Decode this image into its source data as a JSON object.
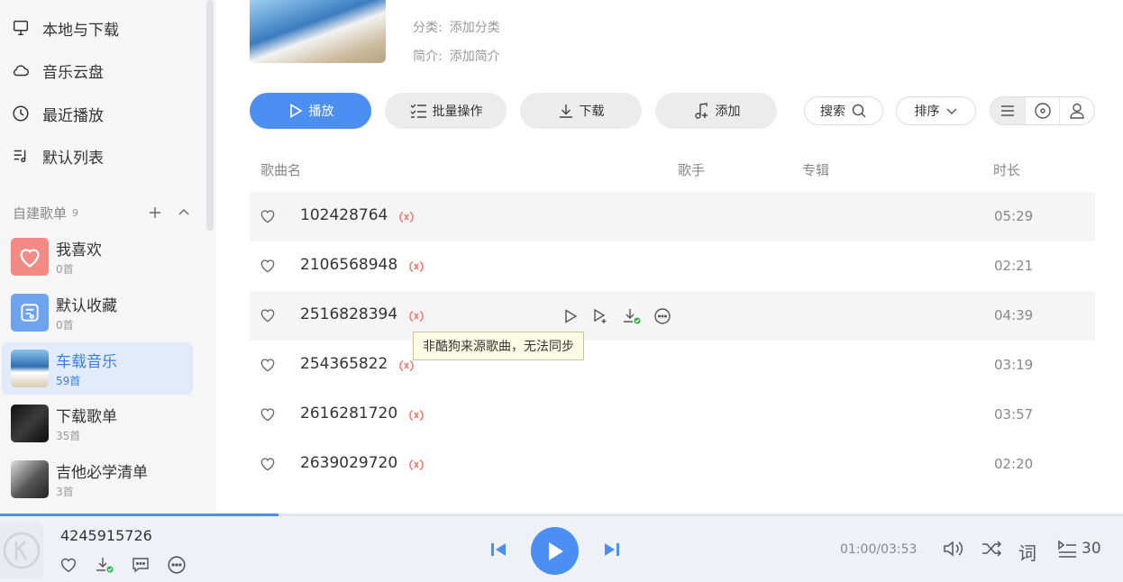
{
  "sidebar": {
    "nav": [
      {
        "label": "本地与下载",
        "icon": "monitor-icon"
      },
      {
        "label": "音乐云盘",
        "icon": "cloud-icon"
      },
      {
        "label": "最近播放",
        "icon": "clock-icon"
      },
      {
        "label": "默认列表",
        "icon": "playlist-icon"
      }
    ],
    "section": {
      "title": "自建歌单",
      "count": "9"
    },
    "playlists": [
      {
        "name": "我喜欢",
        "count": "0首"
      },
      {
        "name": "默认收藏",
        "count": "0首"
      },
      {
        "name": "车载音乐",
        "count": "59首"
      },
      {
        "name": "下载歌单",
        "count": "35首"
      },
      {
        "name": "吉他必学清单",
        "count": "3首"
      }
    ]
  },
  "header": {
    "category_label": "分类:",
    "category_value": "添加分类",
    "intro_label": "简介:",
    "intro_value": "添加简介"
  },
  "toolbar": {
    "play": "播放",
    "batch": "批量操作",
    "download": "下载",
    "add": "添加",
    "search": "搜索",
    "sort": "排序"
  },
  "columns": {
    "song": "歌曲名",
    "artist": "歌手",
    "album": "专辑",
    "duration": "时长"
  },
  "songs": [
    {
      "title": "102428764",
      "duration": "05:29"
    },
    {
      "title": "2106568948",
      "duration": "02:21"
    },
    {
      "title": "2516828394",
      "duration": "04:39"
    },
    {
      "title": "254365822",
      "duration": "03:19"
    },
    {
      "title": "2616281720",
      "duration": "03:57"
    },
    {
      "title": "2639029720",
      "duration": "02:20"
    }
  ],
  "tooltip": "非酷狗来源歌曲，无法同步",
  "player": {
    "title": "4245915726",
    "time": "01:00/03:53",
    "progress_fraction": 0.248,
    "lyrics_label": "词",
    "queue_count": "30",
    "accent": "#4c8ff3"
  }
}
